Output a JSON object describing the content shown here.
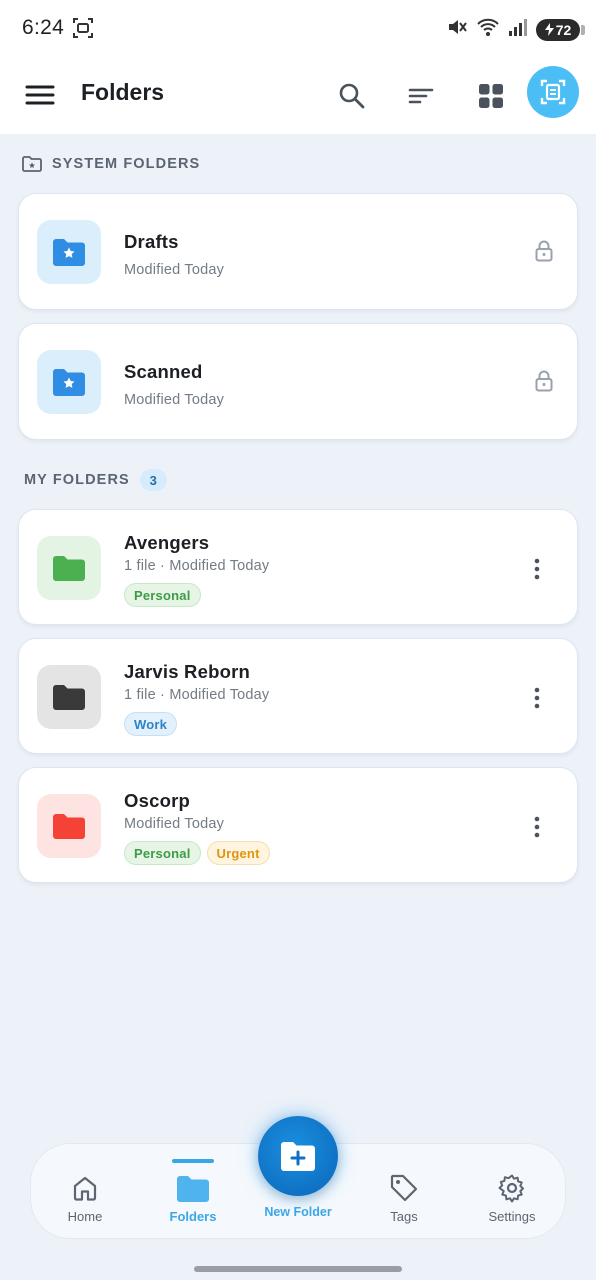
{
  "status_bar": {
    "time": "6:24",
    "battery": "72"
  },
  "app_bar": {
    "title": "Folders"
  },
  "system_section": {
    "title": "SYSTEM FOLDERS"
  },
  "system_folders": [
    {
      "name": "Drafts",
      "modified": "Modified Today"
    },
    {
      "name": "Scanned",
      "modified": "Modified Today"
    }
  ],
  "my_section": {
    "title": "MY FOLDERS",
    "count": "3"
  },
  "my_folders": [
    {
      "name": "Avengers",
      "meta": "1 file  ·  Modified Today",
      "color": "#4caf50",
      "bg": "#e4f4e4",
      "tags": [
        "Personal"
      ]
    },
    {
      "name": "Jarvis Reborn",
      "meta": "1 file  ·  Modified Today",
      "color": "#3a3a3a",
      "bg": "#e4e4e4",
      "tags": [
        "Work"
      ]
    },
    {
      "name": "Oscorp",
      "meta": "Modified Today",
      "color": "#f44336",
      "bg": "#fde3e1",
      "tags": [
        "Personal",
        "Urgent"
      ]
    }
  ],
  "bottom_nav": {
    "home": "Home",
    "folders": "Folders",
    "new_folder": "New Folder",
    "tags": "Tags",
    "settings": "Settings"
  },
  "colors": {
    "accent": "#3aa7e6",
    "fab": "#0a66b8",
    "system_folder": "#2f8de4"
  }
}
